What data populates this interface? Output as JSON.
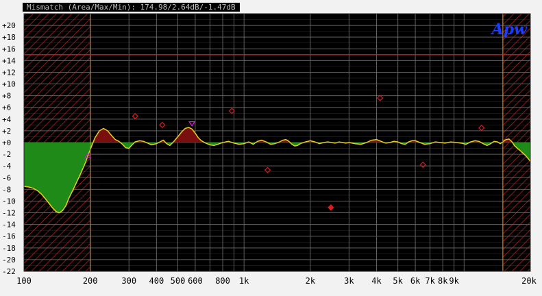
{
  "title": "Mismatch (Area/Max/Min): 174.98/2.64dB/-1.47dB",
  "brand": "Apw",
  "colors": {
    "plot_bg": "#000000",
    "grid": "#6a6a6a",
    "hatch": "#b02020",
    "band_edge": "#d8801a",
    "limit_line": "#c81e1e",
    "positive_fill": "#7a0f0f",
    "negative_fill": "#1f8a18",
    "curve": "#e8d020",
    "marker": "#d81e1e",
    "marker_magenta": "#d020d0",
    "tick_text": "#000000"
  },
  "chart_data": {
    "type": "area",
    "xscale": "log",
    "xlim": [
      100,
      20000
    ],
    "ylim": [
      -22,
      22
    ],
    "grid": true,
    "x_tick_values": [
      100,
      200,
      300,
      400,
      500,
      600,
      800,
      1000,
      2000,
      3000,
      4000,
      5000,
      6000,
      7000,
      8000,
      9000,
      20000
    ],
    "x_tick_labels": [
      "100",
      "200",
      "300",
      "400",
      "500",
      "600",
      "800",
      "1k",
      "2k",
      "3k",
      "4k",
      "5k",
      "6k",
      "7k",
      "8k",
      "9k",
      "20k"
    ],
    "y_tick_values": [
      20,
      18,
      16,
      14,
      12,
      10,
      8,
      6,
      4,
      2,
      0,
      -2,
      -4,
      -6,
      -8,
      -10,
      -12,
      -14,
      -16,
      -18,
      -20,
      -22
    ],
    "y_tick_labels": [
      "+20",
      "+18",
      "+16",
      "+14",
      "+12",
      "+10",
      "+8",
      "+6",
      "+4",
      "+2",
      "+0",
      "-2",
      "-4",
      "-6",
      "-8",
      "-10",
      "-12",
      "-14",
      "-16",
      "-18",
      "-20",
      "-22"
    ],
    "hatched_bands": [
      [
        100,
        200
      ],
      [
        15000,
        20000
      ]
    ],
    "limit_line_y": 15,
    "curve": {
      "x": [
        100,
        105,
        110,
        115,
        120,
        125,
        130,
        135,
        140,
        145,
        150,
        155,
        160,
        170,
        180,
        190,
        200,
        210,
        220,
        230,
        240,
        250,
        260,
        270,
        280,
        290,
        300,
        310,
        320,
        335,
        350,
        365,
        380,
        400,
        415,
        430,
        445,
        460,
        480,
        500,
        520,
        540,
        560,
        580,
        600,
        620,
        640,
        670,
        700,
        730,
        760,
        800,
        850,
        900,
        950,
        1000,
        1050,
        1100,
        1150,
        1200,
        1260,
        1320,
        1380,
        1450,
        1500,
        1550,
        1600,
        1650,
        1700,
        1750,
        1800,
        1900,
        2000,
        2100,
        2200,
        2300,
        2400,
        2500,
        2600,
        2700,
        2800,
        2900,
        3000,
        3200,
        3400,
        3600,
        3800,
        4000,
        4200,
        4400,
        4600,
        4800,
        5000,
        5200,
        5400,
        5600,
        5800,
        6000,
        6300,
        6600,
        7000,
        7400,
        7800,
        8200,
        8700,
        9200,
        9700,
        10200,
        10700,
        11200,
        11700,
        12200,
        12700,
        13200,
        13700,
        14200,
        14600,
        15000,
        15500,
        16000,
        16500,
        17000,
        18000,
        19000,
        20000
      ],
      "y": [
        -7.5,
        -7.6,
        -7.8,
        -8.2,
        -8.8,
        -9.6,
        -10.4,
        -11.2,
        -11.8,
        -12.0,
        -11.6,
        -10.8,
        -9.5,
        -7.5,
        -5.5,
        -3.5,
        -1.2,
        0.8,
        2.0,
        2.4,
        2.0,
        1.2,
        0.5,
        0.2,
        -0.3,
        -0.9,
        -1.0,
        -0.4,
        0.1,
        0.3,
        0.2,
        -0.1,
        -0.4,
        -0.2,
        0.1,
        0.4,
        -0.2,
        -0.5,
        0.2,
        1.0,
        1.8,
        2.4,
        2.6,
        2.3,
        1.6,
        0.8,
        0.3,
        -0.1,
        -0.4,
        -0.5,
        -0.3,
        0.0,
        0.2,
        -0.1,
        -0.3,
        -0.2,
        0.1,
        -0.3,
        0.2,
        0.4,
        0.1,
        -0.3,
        -0.2,
        0.1,
        0.4,
        0.5,
        0.2,
        -0.3,
        -0.6,
        -0.5,
        -0.2,
        0.1,
        0.3,
        0.1,
        -0.2,
        0.0,
        0.1,
        0.0,
        -0.1,
        0.1,
        0.0,
        -0.1,
        0.0,
        -0.2,
        -0.3,
        0.0,
        0.4,
        0.5,
        0.2,
        -0.1,
        0.0,
        0.2,
        0.1,
        -0.2,
        -0.3,
        0.1,
        0.3,
        0.3,
        0.0,
        -0.3,
        -0.2,
        0.1,
        0.0,
        -0.1,
        0.1,
        0.0,
        -0.1,
        -0.3,
        0.1,
        0.3,
        0.2,
        -0.2,
        -0.5,
        -0.2,
        0.2,
        0.1,
        -0.2,
        0.1,
        0.5,
        0.6,
        0.1,
        -0.6,
        -1.4,
        -2.2,
        -3.2,
        -4.1,
        -4.8
      ]
    },
    "markers": [
      {
        "x": 320,
        "y": 4.5,
        "shape": "open-diamond"
      },
      {
        "x": 425,
        "y": 3.0,
        "shape": "open-diamond"
      },
      {
        "x": 880,
        "y": 5.4,
        "shape": "open-diamond"
      },
      {
        "x": 1280,
        "y": -4.7,
        "shape": "open-diamond"
      },
      {
        "x": 2480,
        "y": -11.1,
        "shape": "filled-diamond"
      },
      {
        "x": 4150,
        "y": 7.6,
        "shape": "open-diamond"
      },
      {
        "x": 6500,
        "y": -3.8,
        "shape": "open-diamond"
      },
      {
        "x": 12000,
        "y": 2.5,
        "shape": "open-diamond"
      }
    ],
    "max_marker": {
      "x": 580,
      "y": 3.2,
      "shape": "triangle-down"
    },
    "min_marker": {
      "x": 195,
      "y": -2.2,
      "shape": "triangle-up"
    }
  }
}
